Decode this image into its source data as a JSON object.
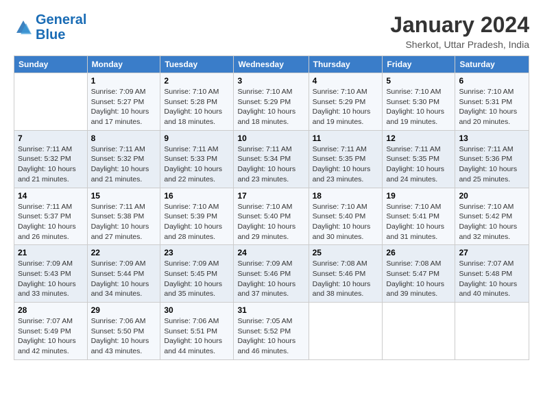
{
  "logo": {
    "line1": "General",
    "line2": "Blue"
  },
  "title": "January 2024",
  "subtitle": "Sherkot, Uttar Pradesh, India",
  "days_header": [
    "Sunday",
    "Monday",
    "Tuesday",
    "Wednesday",
    "Thursday",
    "Friday",
    "Saturday"
  ],
  "weeks": [
    [
      {
        "num": "",
        "sunrise": "",
        "sunset": "",
        "daylight": ""
      },
      {
        "num": "1",
        "sunrise": "Sunrise: 7:09 AM",
        "sunset": "Sunset: 5:27 PM",
        "daylight": "Daylight: 10 hours and 17 minutes."
      },
      {
        "num": "2",
        "sunrise": "Sunrise: 7:10 AM",
        "sunset": "Sunset: 5:28 PM",
        "daylight": "Daylight: 10 hours and 18 minutes."
      },
      {
        "num": "3",
        "sunrise": "Sunrise: 7:10 AM",
        "sunset": "Sunset: 5:29 PM",
        "daylight": "Daylight: 10 hours and 18 minutes."
      },
      {
        "num": "4",
        "sunrise": "Sunrise: 7:10 AM",
        "sunset": "Sunset: 5:29 PM",
        "daylight": "Daylight: 10 hours and 19 minutes."
      },
      {
        "num": "5",
        "sunrise": "Sunrise: 7:10 AM",
        "sunset": "Sunset: 5:30 PM",
        "daylight": "Daylight: 10 hours and 19 minutes."
      },
      {
        "num": "6",
        "sunrise": "Sunrise: 7:10 AM",
        "sunset": "Sunset: 5:31 PM",
        "daylight": "Daylight: 10 hours and 20 minutes."
      }
    ],
    [
      {
        "num": "7",
        "sunrise": "Sunrise: 7:11 AM",
        "sunset": "Sunset: 5:32 PM",
        "daylight": "Daylight: 10 hours and 21 minutes."
      },
      {
        "num": "8",
        "sunrise": "Sunrise: 7:11 AM",
        "sunset": "Sunset: 5:32 PM",
        "daylight": "Daylight: 10 hours and 21 minutes."
      },
      {
        "num": "9",
        "sunrise": "Sunrise: 7:11 AM",
        "sunset": "Sunset: 5:33 PM",
        "daylight": "Daylight: 10 hours and 22 minutes."
      },
      {
        "num": "10",
        "sunrise": "Sunrise: 7:11 AM",
        "sunset": "Sunset: 5:34 PM",
        "daylight": "Daylight: 10 hours and 23 minutes."
      },
      {
        "num": "11",
        "sunrise": "Sunrise: 7:11 AM",
        "sunset": "Sunset: 5:35 PM",
        "daylight": "Daylight: 10 hours and 23 minutes."
      },
      {
        "num": "12",
        "sunrise": "Sunrise: 7:11 AM",
        "sunset": "Sunset: 5:35 PM",
        "daylight": "Daylight: 10 hours and 24 minutes."
      },
      {
        "num": "13",
        "sunrise": "Sunrise: 7:11 AM",
        "sunset": "Sunset: 5:36 PM",
        "daylight": "Daylight: 10 hours and 25 minutes."
      }
    ],
    [
      {
        "num": "14",
        "sunrise": "Sunrise: 7:11 AM",
        "sunset": "Sunset: 5:37 PM",
        "daylight": "Daylight: 10 hours and 26 minutes."
      },
      {
        "num": "15",
        "sunrise": "Sunrise: 7:11 AM",
        "sunset": "Sunset: 5:38 PM",
        "daylight": "Daylight: 10 hours and 27 minutes."
      },
      {
        "num": "16",
        "sunrise": "Sunrise: 7:10 AM",
        "sunset": "Sunset: 5:39 PM",
        "daylight": "Daylight: 10 hours and 28 minutes."
      },
      {
        "num": "17",
        "sunrise": "Sunrise: 7:10 AM",
        "sunset": "Sunset: 5:40 PM",
        "daylight": "Daylight: 10 hours and 29 minutes."
      },
      {
        "num": "18",
        "sunrise": "Sunrise: 7:10 AM",
        "sunset": "Sunset: 5:40 PM",
        "daylight": "Daylight: 10 hours and 30 minutes."
      },
      {
        "num": "19",
        "sunrise": "Sunrise: 7:10 AM",
        "sunset": "Sunset: 5:41 PM",
        "daylight": "Daylight: 10 hours and 31 minutes."
      },
      {
        "num": "20",
        "sunrise": "Sunrise: 7:10 AM",
        "sunset": "Sunset: 5:42 PM",
        "daylight": "Daylight: 10 hours and 32 minutes."
      }
    ],
    [
      {
        "num": "21",
        "sunrise": "Sunrise: 7:09 AM",
        "sunset": "Sunset: 5:43 PM",
        "daylight": "Daylight: 10 hours and 33 minutes."
      },
      {
        "num": "22",
        "sunrise": "Sunrise: 7:09 AM",
        "sunset": "Sunset: 5:44 PM",
        "daylight": "Daylight: 10 hours and 34 minutes."
      },
      {
        "num": "23",
        "sunrise": "Sunrise: 7:09 AM",
        "sunset": "Sunset: 5:45 PM",
        "daylight": "Daylight: 10 hours and 35 minutes."
      },
      {
        "num": "24",
        "sunrise": "Sunrise: 7:09 AM",
        "sunset": "Sunset: 5:46 PM",
        "daylight": "Daylight: 10 hours and 37 minutes."
      },
      {
        "num": "25",
        "sunrise": "Sunrise: 7:08 AM",
        "sunset": "Sunset: 5:46 PM",
        "daylight": "Daylight: 10 hours and 38 minutes."
      },
      {
        "num": "26",
        "sunrise": "Sunrise: 7:08 AM",
        "sunset": "Sunset: 5:47 PM",
        "daylight": "Daylight: 10 hours and 39 minutes."
      },
      {
        "num": "27",
        "sunrise": "Sunrise: 7:07 AM",
        "sunset": "Sunset: 5:48 PM",
        "daylight": "Daylight: 10 hours and 40 minutes."
      }
    ],
    [
      {
        "num": "28",
        "sunrise": "Sunrise: 7:07 AM",
        "sunset": "Sunset: 5:49 PM",
        "daylight": "Daylight: 10 hours and 42 minutes."
      },
      {
        "num": "29",
        "sunrise": "Sunrise: 7:06 AM",
        "sunset": "Sunset: 5:50 PM",
        "daylight": "Daylight: 10 hours and 43 minutes."
      },
      {
        "num": "30",
        "sunrise": "Sunrise: 7:06 AM",
        "sunset": "Sunset: 5:51 PM",
        "daylight": "Daylight: 10 hours and 44 minutes."
      },
      {
        "num": "31",
        "sunrise": "Sunrise: 7:05 AM",
        "sunset": "Sunset: 5:52 PM",
        "daylight": "Daylight: 10 hours and 46 minutes."
      },
      {
        "num": "",
        "sunrise": "",
        "sunset": "",
        "daylight": ""
      },
      {
        "num": "",
        "sunrise": "",
        "sunset": "",
        "daylight": ""
      },
      {
        "num": "",
        "sunrise": "",
        "sunset": "",
        "daylight": ""
      }
    ]
  ]
}
